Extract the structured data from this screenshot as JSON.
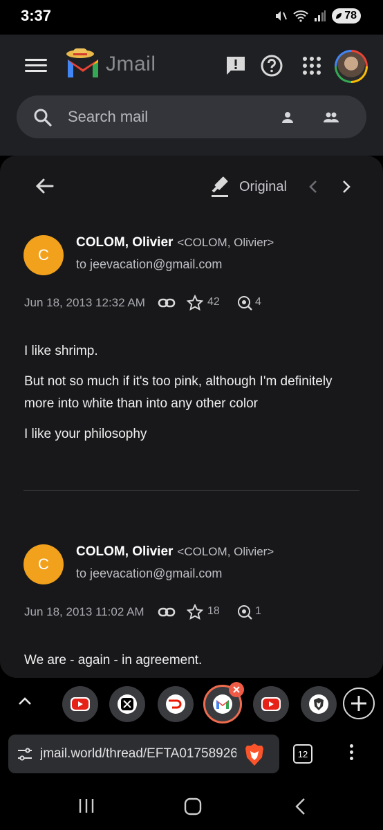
{
  "status_bar": {
    "time": "3:37",
    "battery": "78"
  },
  "header": {
    "app_name": "Jmail",
    "search_placeholder": "Search mail"
  },
  "thread": {
    "view_label": "Original",
    "messages": [
      {
        "avatar_letter": "C",
        "sender_name": "COLOM, Olivier",
        "sender_address": "<COLOM, Olivier>",
        "recipient": "to jeevacation@gmail.com",
        "date": "Jun 18, 2013 12:32 AM",
        "stars": "42",
        "views": "4",
        "body": [
          "I like shrimp.",
          "But not so much if it's too pink, although I'm definitely more into white than into any other color",
          "I like your philosophy"
        ]
      },
      {
        "avatar_letter": "C",
        "sender_name": "COLOM, Olivier",
        "sender_address": "<COLOM, Olivier>",
        "recipient": "to jeevacation@gmail.com",
        "date": "Jun 18, 2013 11:02 AM",
        "stars": "18",
        "views": "1",
        "body": [
          "We are - again - in agreement."
        ]
      }
    ]
  },
  "browser": {
    "tabs": [
      {
        "icon": "youtube-icon"
      },
      {
        "icon": "x-icon"
      },
      {
        "icon": "doordash-icon"
      },
      {
        "icon": "gmail-icon",
        "active": true
      },
      {
        "icon": "youtube-icon"
      },
      {
        "icon": "brave-icon"
      }
    ],
    "url": "jmail.world/thread/EFTA01758926",
    "tab_count": "12"
  },
  "colors": {
    "avatar": "#f2a11c",
    "active_tab_ring": "#f06c4f",
    "card_bg": "#18181b",
    "header_bg": "#1f2024"
  }
}
